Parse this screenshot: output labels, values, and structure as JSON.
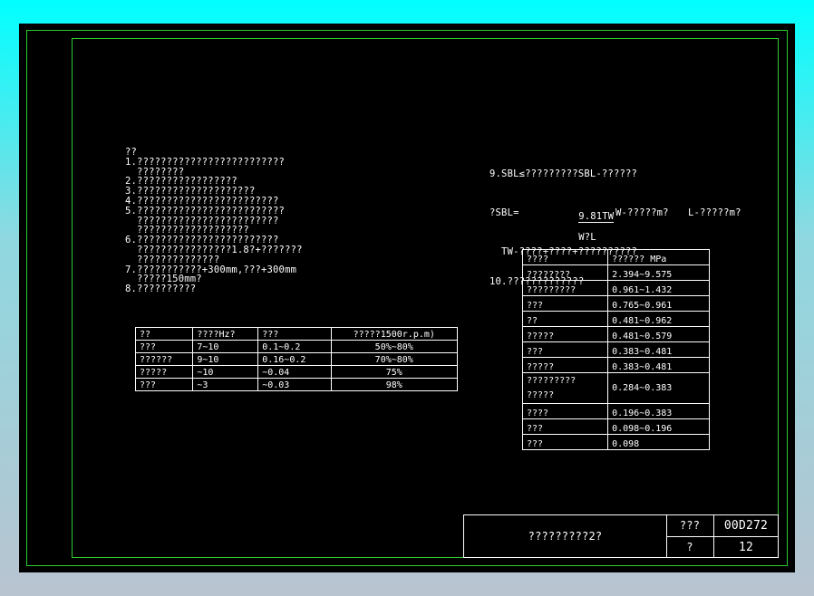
{
  "notes_left": [
    "??",
    "1.?????????????????????????",
    "  ????????",
    "2.?????????????????",
    "3.????????????????????",
    "4.????????????????????????",
    "5.?????????????????????????",
    "  ????????????????????????",
    "  ???????????????????",
    "6.????????????????????????",
    "  ????????????????1.8?+???????",
    "  ??????????????",
    "7.???????????+300mm,???+300mm",
    "  ?????150mm?",
    "8.??????????"
  ],
  "notes_right": {
    "line9": "9.SBL≤?????????SBL-??????",
    "formula_lhs": "?SBL=",
    "formula_num": "9.81TW",
    "formula_den": "W?L",
    "formula_w": "W-?????m?",
    "formula_l": "L-?????m?",
    "line_tw": "  TW-????+????+??????????",
    "line10": "10.?????????????"
  },
  "vib_table": {
    "headers": [
      "??",
      "????Hz?",
      "???",
      "?????1500r.p.m)"
    ],
    "rows": [
      [
        "???",
        "7~10",
        "0.1~0.2",
        "50%~80%"
      ],
      [
        "??????",
        "9~10",
        "0.16~0.2",
        "70%~80%"
      ],
      [
        "?????",
        "~10",
        "~0.04",
        "75%"
      ],
      [
        "???",
        "~3",
        "~0.03",
        "98%"
      ]
    ]
  },
  "soil_table": {
    "headers": [
      "????",
      "?????? MPa"
    ],
    "rows": [
      [
        "????????",
        "2.394~9.575"
      ],
      [
        "?????????",
        "0.961~1.432"
      ],
      [
        "???",
        "0.765~0.961"
      ],
      [
        "??",
        "0.481~0.962"
      ],
      [
        "?????",
        "0.481~0.579"
      ],
      [
        "???",
        "0.383~0.481"
      ],
      [
        "?????",
        "0.383~0.481"
      ],
      [
        "?????????\n?????",
        "0.284~0.383"
      ],
      [
        "????",
        "0.196~0.383"
      ],
      [
        "???",
        "0.098~0.196"
      ],
      [
        "???",
        "0.098"
      ]
    ]
  },
  "title_block": {
    "title": "?????????2?",
    "label1": "???",
    "value1": "00D272",
    "label2": "?",
    "value2": "12"
  },
  "colors": {
    "background": "#000000",
    "frame": "#2ecc2e",
    "text": "#ffffff"
  }
}
